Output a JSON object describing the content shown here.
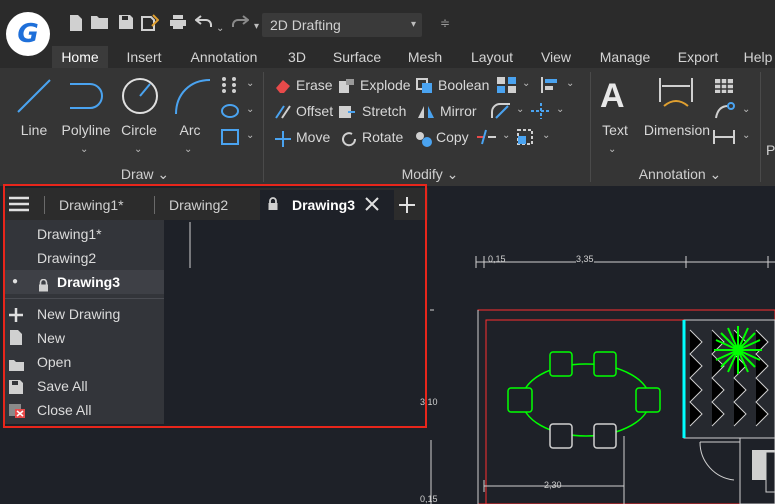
{
  "app": {
    "logo_letter": "G",
    "workspace": "2D Drafting"
  },
  "ribbon_tabs": [
    "Home",
    "Insert",
    "Annotation",
    "3D",
    "Surface",
    "Mesh",
    "Layout",
    "View",
    "Manage",
    "Export",
    "Help"
  ],
  "draw_panel": {
    "tools": [
      "Line",
      "Polyline",
      "Circle",
      "Arc"
    ],
    "title": "Draw"
  },
  "modify_panel": {
    "col1": [
      "Erase",
      "Offset",
      "Move"
    ],
    "col2": [
      "Explode",
      "Stretch",
      "Rotate"
    ],
    "col3": [
      "Boolean",
      "Mirror",
      "Copy"
    ],
    "title": "Modify"
  },
  "annotation_panel": {
    "text_label": "Text",
    "dimension_label": "Dimension",
    "title": "Annotation"
  },
  "doc_tabs": [
    {
      "label": "Drawing1*"
    },
    {
      "label": "Drawing2"
    },
    {
      "label": "Drawing3"
    }
  ],
  "menu": {
    "drawings": [
      "Drawing1*",
      "Drawing2",
      "Drawing3"
    ],
    "actions": [
      "New Drawing",
      "New",
      "Open",
      "Save All",
      "Close All"
    ]
  },
  "drawing": {
    "dim_top_small": "0,15",
    "dim_top_main": "3,35",
    "dim_left": "3,10",
    "dim_bottom": "2,30",
    "dim_left_bottom": "0,15"
  },
  "colors": {
    "accent_red": "#e8261b",
    "cad_green": "#00ff00",
    "cad_red": "#ff3030",
    "cad_cyan": "#00ffff"
  }
}
